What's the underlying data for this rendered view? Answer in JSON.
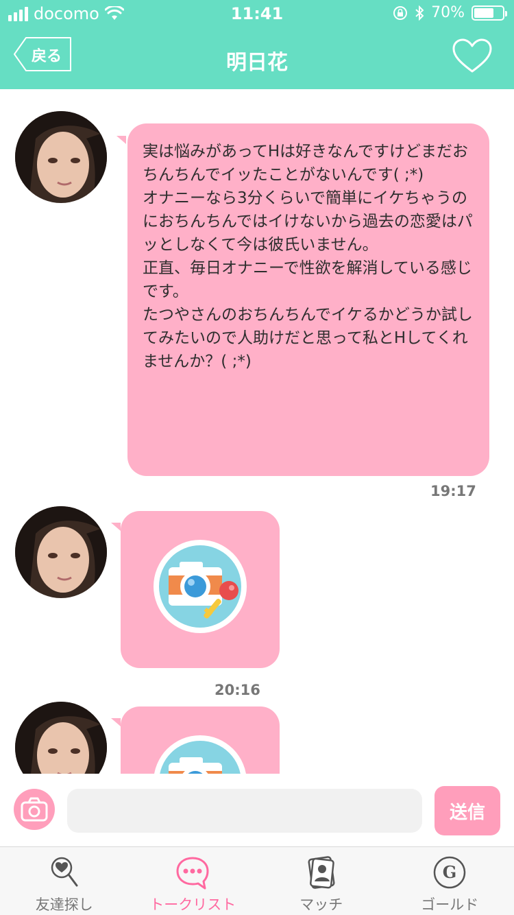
{
  "status_bar": {
    "carrier": "docomo",
    "time": "11:41",
    "battery": "70%",
    "battery_level": 0.7
  },
  "nav": {
    "back_label": "戻る",
    "title": "明日花"
  },
  "messages": [
    {
      "type": "text",
      "text": "実は悩みがあってHは好きなんですけどまだおちんちんでイッたことがないんです( ;*)\nオナニーなら3分くらいで簡単にイケちゃうのにおちんちんではイけないから過去の恋愛はパッとしなくて今は彼氏いません。\n正直、毎日オナニーで性欲を解消している感じです。\nたつやさんのおちんちんでイケるかどうか試してみたいので人助けだと思って私とHしてくれませんか？( ;*)",
      "time": "19:17"
    },
    {
      "type": "locked-photo",
      "icon": "camera-key-icon",
      "time": "20:16"
    },
    {
      "type": "locked-photo",
      "icon": "camera-key-icon"
    }
  ],
  "input": {
    "placeholder": "",
    "send_label": "送信"
  },
  "tabs": [
    {
      "label": "友達探し",
      "icon": "heart-search-icon",
      "active": false
    },
    {
      "label": "トークリスト",
      "icon": "chat-bubble-icon",
      "active": true
    },
    {
      "label": "マッチ",
      "icon": "profile-card-icon",
      "active": false
    },
    {
      "label": "ゴールド",
      "icon": "gold-coin-icon",
      "active": false
    }
  ],
  "colors": {
    "header": "#66dec3",
    "bubble": "#ffb0c8",
    "accent": "#ff9ebb",
    "active_tab": "#ff69a0"
  }
}
